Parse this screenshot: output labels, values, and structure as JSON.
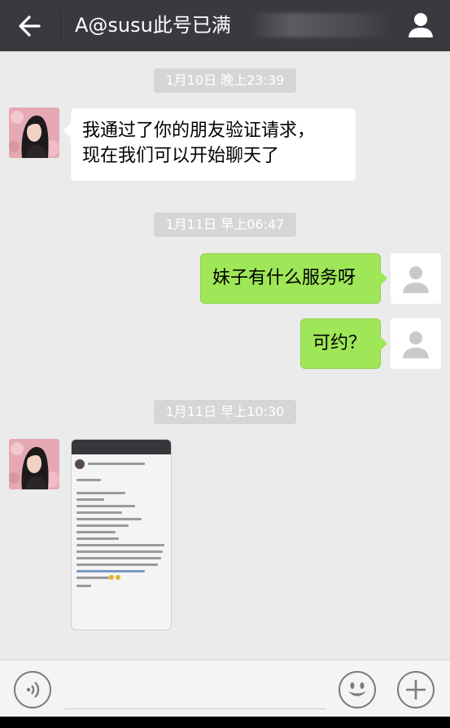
{
  "header": {
    "title": "A@susu此号已满",
    "colors": {
      "bar": "#393a3f"
    }
  },
  "messages": [
    {
      "type": "time",
      "text": "1月10日 晚上23:39"
    },
    {
      "type": "text",
      "side": "left",
      "text_line1": "我通过了你的朋友验证请求，",
      "text_line2": "现在我们可以开始聊天了"
    },
    {
      "type": "time",
      "text": "1月11日 早上06:47"
    },
    {
      "type": "text",
      "side": "right",
      "text": "妹子有什么服务呀"
    },
    {
      "type": "text",
      "side": "right",
      "text": "可约？"
    },
    {
      "type": "time",
      "text": "1月11日 早上10:30"
    },
    {
      "type": "image",
      "side": "left",
      "image_desc": "screenshot"
    }
  ],
  "icons": {
    "back": "arrow-left-icon",
    "profile": "person-icon",
    "voice": "voice-icon",
    "emoji": "smile-icon",
    "more": "plus-icon"
  },
  "colors": {
    "background": "#ebebeb",
    "right_bubble": "#9fe658",
    "left_bubble": "#ffffff",
    "timestamp": "#d6d6d6"
  }
}
